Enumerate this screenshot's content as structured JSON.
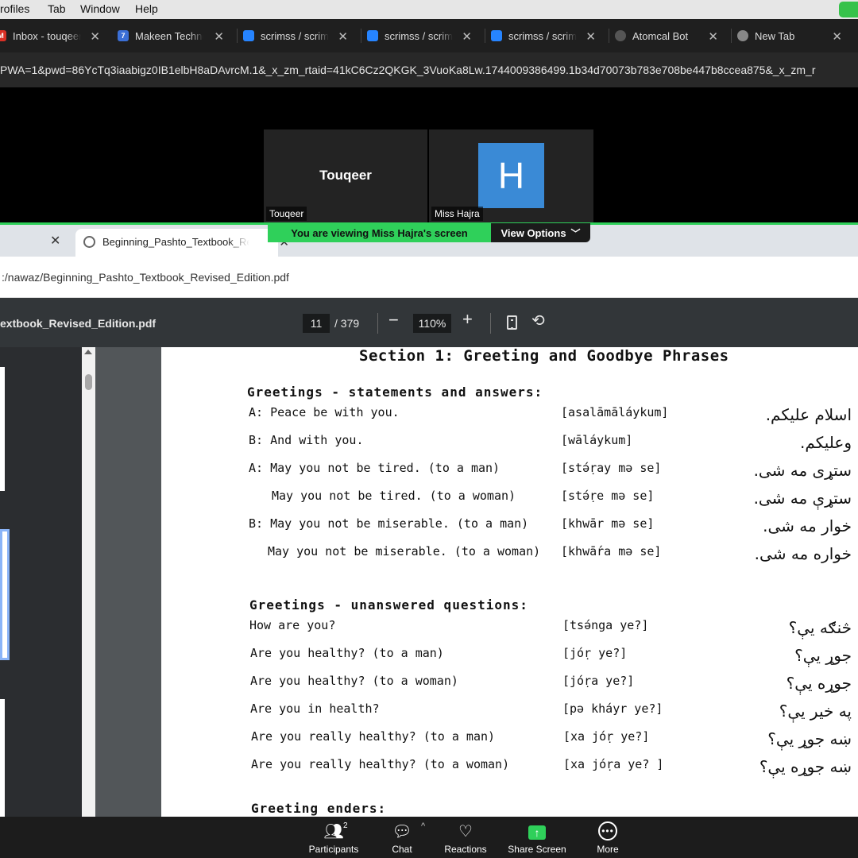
{
  "menubar": {
    "items": [
      "rofiles",
      "Tab",
      "Window",
      "Help"
    ]
  },
  "outer_tabs": [
    {
      "title": "Inbox - touqeer",
      "icon": "gmail-icon",
      "color": "#d93025"
    },
    {
      "title": "Makeen Techno",
      "icon": "makeen-icon",
      "color": "#3b6fd6"
    },
    {
      "title": "scrimss / scrim",
      "icon": "bitbucket-icon",
      "color": "#2684ff"
    },
    {
      "title": "scrimss / scrim",
      "icon": "bitbucket-icon",
      "color": "#2684ff"
    },
    {
      "title": "scrimss / scrim",
      "icon": "bitbucket-icon",
      "color": "#2684ff"
    },
    {
      "title": "Atomcal Bot",
      "icon": "globe-icon",
      "color": "#777777"
    },
    {
      "title": "New Tab",
      "icon": "chrome-icon",
      "color": "#888888"
    }
  ],
  "outer_url": "PWA=1&pwd=86YcTq3iaabigz0IB1elbH8aDAvrcM.1&_x_zm_rtaid=41kC6Cz2QKGK_3VuoKa8Lw.1744009386499.1b34d70073b783e708be447b8ccea875&_x_zm_r",
  "meeting": {
    "participants": [
      {
        "center_name": "Touqeer",
        "label": "Touqeer"
      },
      {
        "avatar_letter": "H",
        "label": "Miss Hajra"
      }
    ],
    "viewing_banner": "You are viewing  Miss Hajra's screen",
    "view_options": "View Options"
  },
  "inner_browser": {
    "tab_title": "Beginning_Pashto_Textbook_Revised_Edition.pdf",
    "url": ":/nawaz/Beginning_Pashto_Textbook_Revised_Edition.pdf"
  },
  "pdf_toolbar": {
    "file_name": "extbook_Revised_Edition.pdf",
    "page_current": "11",
    "page_total": "/ 379",
    "zoom": "110%"
  },
  "pdf_page": {
    "section_title": "Section 1:  Greeting and Goodbye Phrases",
    "heading_1": "Greetings - statements and answers:",
    "rows_1": [
      {
        "en": "A: Peace be with you.",
        "tr": "[asalāmāláykum]",
        "ps": "اسلام علیکم."
      },
      {
        "en": "B:  And with you.",
        "tr": "[wāláykum]",
        "ps": "وعلیکم."
      },
      {
        "en": "A:  May you not be tired.  (to a man)",
        "tr": "[stə́ṛay mə se]",
        "ps": "ستړی مه شی."
      },
      {
        "en": "May you not be tired. (to a woman)",
        "tr": "[stə́ṛe mə se]",
        "ps": "ستړې مه شی."
      },
      {
        "en": "B:  May you not be miserable.  (to a man)",
        "tr": "[khwār mə se]",
        "ps": "خوار مه شی."
      },
      {
        "en": "May you not be miserable. (to a woman)",
        "tr": "[khwā́ra mə se]",
        "ps": "خواره مه شی."
      }
    ],
    "heading_2": "Greetings - unanswered questions:",
    "rows_2": [
      {
        "en": "How are you?",
        "tr": "[tsə́nga ye?]",
        "ps": "څنګه يې؟"
      },
      {
        "en": "Are you healthy? (to a man)",
        "tr": "[jóṛ ye?]",
        "ps": "جوړ يې؟"
      },
      {
        "en": "Are you healthy? (to a woman)",
        "tr": "[jóṛa ye?]",
        "ps": "جوړه يې؟"
      },
      {
        "en": "Are you in health?",
        "tr": "[pə kháyr ye?]",
        "ps": "په خير يې؟"
      },
      {
        "en": "Are you really healthy? (to a man)",
        "tr": "[xa jóṛ ye?]",
        "ps": "ښه جوړ يې؟"
      },
      {
        "en": "Are you really healthy? (to a woman)",
        "tr": "[xa jóṛa ye? ]",
        "ps": "ښه جوړه يې؟"
      }
    ],
    "heading_3": "Greeting enders:"
  },
  "zoom_toolbar": {
    "participants": "Participants",
    "participants_count": "2",
    "chat": "Chat",
    "reactions": "Reactions",
    "share_screen": "Share Screen",
    "more": "More"
  },
  "colors": {
    "zoom_green": "#2fd05a",
    "avatar_blue": "#3a8ad6",
    "pdf_toolbar": "#323639"
  }
}
